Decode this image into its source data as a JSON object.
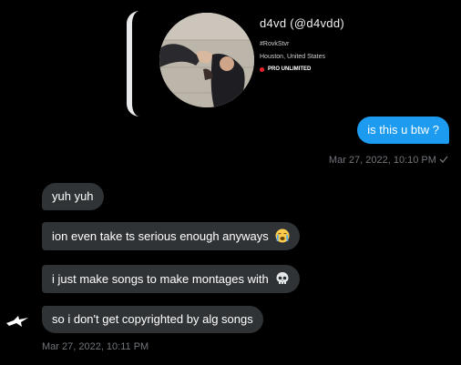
{
  "card": {
    "name": "d4vd (@d4vdd)",
    "tag": "#RovkStvr",
    "location": "Houston, United States",
    "badge": "PRO UNLIMITED"
  },
  "outgoing": {
    "text": "is this u btw ?",
    "timestamp": "Mar 27, 2022, 10:10 PM",
    "status_icon": "check-icon"
  },
  "incoming": {
    "messages": [
      {
        "text": "yuh yuh"
      },
      {
        "text": "ion even take ts serious enough anyways",
        "emoji": "loudly-crying-face"
      },
      {
        "text": "i just make songs to make montages with",
        "emoji": "skull"
      },
      {
        "text": "so i don't get copyrighted by alg songs"
      }
    ],
    "timestamp": "Mar 27, 2022, 10:11 PM",
    "sender_icon": "bird-logo-icon"
  },
  "colors": {
    "accent": "#1d9bf0",
    "incoming_bubble": "#2f3336",
    "muted": "#71767b",
    "badge_dot": "#f4212e"
  }
}
